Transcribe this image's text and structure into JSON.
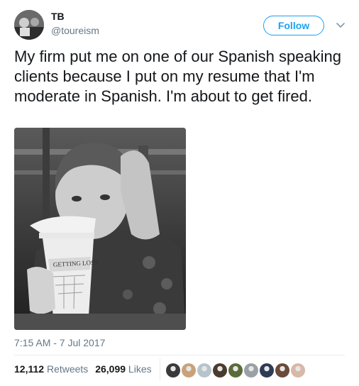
{
  "user": {
    "name": "TB",
    "handle": "@toureism"
  },
  "follow_label": "Follow",
  "tweet_text": "My firm put me on one of our Spanish speaking clients because I put on my resume that I'm moderate in Spanish. I'm about to get fired.",
  "photo": {
    "cup_text": "GETTING LOST"
  },
  "timestamp": "7:15 AM - 7 Jul 2017",
  "stats": {
    "retweets_count": "12,112",
    "retweets_label": "Retweets",
    "likes_count": "26,099",
    "likes_label": "Likes"
  },
  "colors": {
    "accent": "#1da1f2",
    "muted": "#657786",
    "text": "#14171a"
  },
  "icons": {
    "more": "chevron-down-icon"
  },
  "likers": [
    {
      "color": "#3a3a3a"
    },
    {
      "color": "#c9a27a"
    },
    {
      "color": "#b8c4cc"
    },
    {
      "color": "#4a3b2f"
    },
    {
      "color": "#5a6b3a"
    },
    {
      "color": "#9aa0a6"
    },
    {
      "color": "#2e3b55"
    },
    {
      "color": "#6b4a3a"
    },
    {
      "color": "#d8b8a8"
    }
  ]
}
